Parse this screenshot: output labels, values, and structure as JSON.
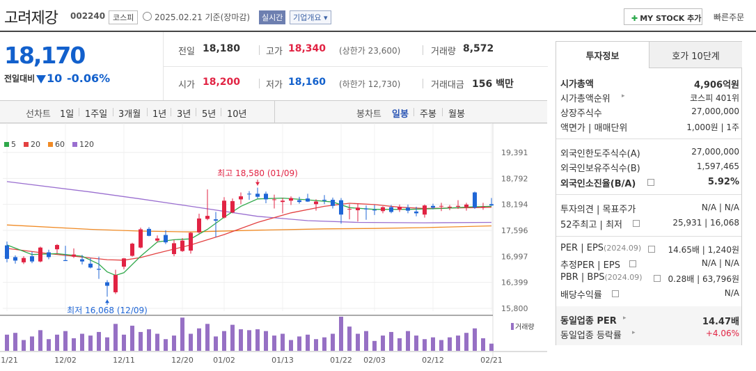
{
  "header": {
    "name": "고려제강",
    "code": "002240",
    "market": "코스피",
    "date": "2025.02.21  기준(장마감)",
    "realtime": "실시간",
    "company": "기업개요 ▾",
    "mystock": "MY STOCK 추가",
    "quick_order": "빠른주문"
  },
  "price": {
    "current": "18,170",
    "compare_label": "전일대비",
    "change": "10",
    "change_pct": "-0.06%",
    "stats": {
      "prev_label": "전일",
      "prev": "18,180",
      "high_label": "고가",
      "high": "18,340",
      "upper_limit": "(상한가 23,600)",
      "volume_label": "거래량",
      "volume": "8,572",
      "open_label": "시가",
      "open": "18,200",
      "low_label": "저가",
      "low": "18,160",
      "lower_limit": "(하한가 12,730)",
      "amount_label": "거래대금",
      "amount": "156 백만"
    }
  },
  "period_bar": {
    "line_label": "선차트",
    "line_periods": [
      "1일",
      "1주일",
      "3개월",
      "1년",
      "3년",
      "5년",
      "10년"
    ],
    "candle_label": "봉차트",
    "candle_periods": [
      "일봉",
      "주봉",
      "월봉"
    ],
    "active": "일봉"
  },
  "chart_data": {
    "type": "candlestick",
    "legend": [
      {
        "name": "5",
        "color": "#2fa84a"
      },
      {
        "name": "20",
        "color": "#e34141"
      },
      {
        "name": "60",
        "color": "#f08a24"
      },
      {
        "name": "120",
        "color": "#9a6fd0"
      }
    ],
    "y_ticks": [
      19391,
      18792,
      18194,
      17596,
      16997,
      16399,
      15800
    ],
    "ylim": [
      15800,
      19391
    ],
    "x_ticks": [
      "11/21",
      "12/02",
      "12/11",
      "12/20",
      "01/02",
      "01/13",
      "01/22",
      "02/03",
      "02/12",
      "02/21"
    ],
    "x_tick_index": [
      0,
      7,
      14,
      21,
      26,
      33,
      40,
      44,
      51,
      58
    ],
    "annotations": {
      "max_label": "최고 18,580 (01/09)",
      "max_index": 30,
      "max_value": 18580,
      "min_label": "최저 16,068 (12/09)",
      "min_index": 12,
      "min_value": 16068
    },
    "volume_label": "거래량",
    "candles": [
      [
        17250,
        17340,
        16860,
        16940
      ],
      [
        16980,
        17020,
        16830,
        16900
      ],
      [
        16860,
        17000,
        16820,
        16960
      ],
      [
        17000,
        17100,
        16840,
        16880
      ],
      [
        16880,
        17220,
        16860,
        17200
      ],
      [
        17090,
        17150,
        16930,
        16980
      ],
      [
        17160,
        17280,
        17060,
        17260
      ],
      [
        16910,
        17240,
        16890,
        16890
      ],
      [
        16990,
        17180,
        16960,
        17040
      ],
      [
        16930,
        17030,
        16810,
        16880
      ],
      [
        16830,
        16960,
        16720,
        16740
      ],
      [
        16710,
        16990,
        16480,
        16690
      ],
      [
        16400,
        16450,
        16068,
        16320
      ],
      [
        16170,
        16690,
        16130,
        16570
      ],
      [
        16760,
        16960,
        16700,
        16950
      ],
      [
        17010,
        17310,
        16990,
        17290
      ],
      [
        17200,
        17660,
        17180,
        17620
      ],
      [
        17630,
        17670,
        17460,
        17470
      ],
      [
        17360,
        17480,
        17320,
        17410
      ],
      [
        17490,
        17600,
        17280,
        17320
      ],
      [
        17050,
        17380,
        17000,
        17300
      ],
      [
        17120,
        17420,
        17100,
        17360
      ],
      [
        17130,
        17560,
        17060,
        17540
      ],
      [
        17550,
        17980,
        17520,
        17870
      ],
      [
        17860,
        18540,
        17830,
        17930
      ],
      [
        17850,
        18020,
        17440,
        17820
      ],
      [
        17890,
        18360,
        17870,
        18280
      ],
      [
        18010,
        18330,
        17990,
        18270
      ],
      [
        18310,
        18470,
        18200,
        18380
      ],
      [
        18440,
        18500,
        18300,
        18430
      ],
      [
        18440,
        18580,
        18330,
        18370
      ],
      [
        18440,
        18490,
        18220,
        18310
      ],
      [
        18300,
        18420,
        18100,
        18310
      ],
      [
        18250,
        18340,
        17990,
        18280
      ],
      [
        18280,
        18380,
        18180,
        18340
      ],
      [
        18290,
        18370,
        18210,
        18250
      ],
      [
        18330,
        18440,
        18250,
        18260
      ],
      [
        18200,
        18310,
        18050,
        18260
      ],
      [
        18300,
        18410,
        18200,
        18280
      ],
      [
        18300,
        18350,
        18100,
        18160
      ],
      [
        18290,
        18340,
        17750,
        17960
      ],
      [
        18080,
        18200,
        17850,
        18090
      ],
      [
        18060,
        18220,
        17800,
        18120
      ],
      [
        18100,
        18170,
        17840,
        18080
      ],
      [
        18070,
        18180,
        17950,
        18060
      ],
      [
        18040,
        18150,
        17990,
        18130
      ],
      [
        18130,
        18180,
        17990,
        18020
      ],
      [
        18070,
        18190,
        18020,
        18140
      ],
      [
        18120,
        18190,
        17990,
        18050
      ],
      [
        18030,
        18140,
        17920,
        17990
      ],
      [
        17960,
        18190,
        17890,
        18170
      ],
      [
        18160,
        18210,
        18080,
        18120
      ],
      [
        18160,
        18230,
        18040,
        18160
      ],
      [
        18120,
        18180,
        18060,
        18140
      ],
      [
        18140,
        18290,
        18090,
        18160
      ],
      [
        18130,
        18230,
        18050,
        18190
      ],
      [
        18470,
        18490,
        18090,
        18120
      ],
      [
        18120,
        18230,
        18070,
        18140
      ],
      [
        18200,
        18340,
        18160,
        18170
      ]
    ],
    "volume": [
      18,
      20,
      12,
      16,
      23,
      13,
      18,
      22,
      14,
      19,
      17,
      21,
      15,
      30,
      18,
      28,
      21,
      24,
      19,
      13,
      17,
      37,
      19,
      25,
      30,
      16,
      22,
      29,
      24,
      23,
      24,
      22,
      17,
      19,
      12,
      16,
      18,
      13,
      15,
      19,
      38,
      27,
      19,
      22,
      11,
      17,
      21,
      14,
      22,
      17,
      13,
      15,
      12,
      15,
      17,
      20,
      25,
      14,
      8
    ],
    "ma5_points": [
      [
        0,
        17260
      ],
      [
        3,
        17040
      ],
      [
        6,
        17060
      ],
      [
        9,
        17000
      ],
      [
        11,
        16820
      ],
      [
        12,
        16640
      ],
      [
        13,
        16560
      ],
      [
        14,
        16620
      ],
      [
        16,
        17000
      ],
      [
        18,
        17330
      ],
      [
        20,
        17380
      ],
      [
        22,
        17400
      ],
      [
        24,
        17620
      ],
      [
        26,
        17900
      ],
      [
        28,
        18150
      ],
      [
        30,
        18320
      ],
      [
        33,
        18340
      ],
      [
        36,
        18300
      ],
      [
        39,
        18250
      ],
      [
        41,
        18120
      ],
      [
        44,
        18080
      ],
      [
        48,
        18080
      ],
      [
        52,
        18100
      ],
      [
        56,
        18140
      ],
      [
        58,
        18150
      ]
    ],
    "ma20_points": [
      [
        0,
        17180
      ],
      [
        5,
        17060
      ],
      [
        10,
        16960
      ],
      [
        12,
        16920
      ],
      [
        14,
        16910
      ],
      [
        16,
        16970
      ],
      [
        18,
        17070
      ],
      [
        22,
        17260
      ],
      [
        26,
        17500
      ],
      [
        30,
        17780
      ],
      [
        34,
        18000
      ],
      [
        38,
        18150
      ],
      [
        41,
        18220
      ],
      [
        44,
        18190
      ],
      [
        47,
        18130
      ],
      [
        50,
        18100
      ],
      [
        53,
        18110
      ],
      [
        56,
        18120
      ],
      [
        58,
        18130
      ]
    ],
    "ma60_points": [
      [
        0,
        17720
      ],
      [
        10,
        17620
      ],
      [
        16,
        17580
      ],
      [
        22,
        17560
      ],
      [
        30,
        17600
      ],
      [
        38,
        17630
      ],
      [
        44,
        17640
      ],
      [
        50,
        17660
      ],
      [
        58,
        17700
      ]
    ],
    "ma120_points": [
      [
        0,
        18720
      ],
      [
        10,
        18480
      ],
      [
        16,
        18320
      ],
      [
        22,
        18150
      ],
      [
        30,
        17920
      ],
      [
        36,
        17820
      ],
      [
        42,
        17780
      ],
      [
        50,
        17770
      ],
      [
        58,
        17780
      ]
    ]
  },
  "panel": {
    "tab_active": "투자정보",
    "tab_other": "호가 10단계",
    "rows1": [
      {
        "k": "시가총액",
        "v": "4,906억원"
      },
      {
        "k": "시가총액순위",
        "v": "코스피 401위"
      },
      {
        "k": "상장주식수",
        "v": "27,000,000"
      },
      {
        "k": "액면가 | 매매단위",
        "v": "1,000원 | 1주"
      }
    ],
    "rows2": [
      {
        "k": "외국인한도주식수(A)",
        "v": "27,000,000"
      },
      {
        "k": "외국인보유주식수(B)",
        "v": "1,597,465"
      },
      {
        "k": "외국인소진율(B/A)",
        "v": "5.92%"
      }
    ],
    "rows3": [
      {
        "k": "투자의견 | 목표주가",
        "v": "N/A | N/A"
      },
      {
        "k": "52주최고 | 최저",
        "v": "25,931 | 16,068"
      }
    ],
    "rows4": [
      {
        "k": "PER | EPS",
        "k2": "(2024.09)",
        "v": "14.65배 | 1,240원"
      },
      {
        "k": "추정PER | EPS",
        "v": "N/A | N/A"
      },
      {
        "k": "PBR | BPS",
        "k2": "(2024.09)",
        "v": "0.28배 | 63,796원"
      },
      {
        "k": "배당수익률",
        "v": "N/A"
      }
    ],
    "rows5": [
      {
        "k": "동일업종 PER",
        "v": "14.47배"
      },
      {
        "k": "동일업종 등락률",
        "v": "+4.06%"
      }
    ]
  }
}
